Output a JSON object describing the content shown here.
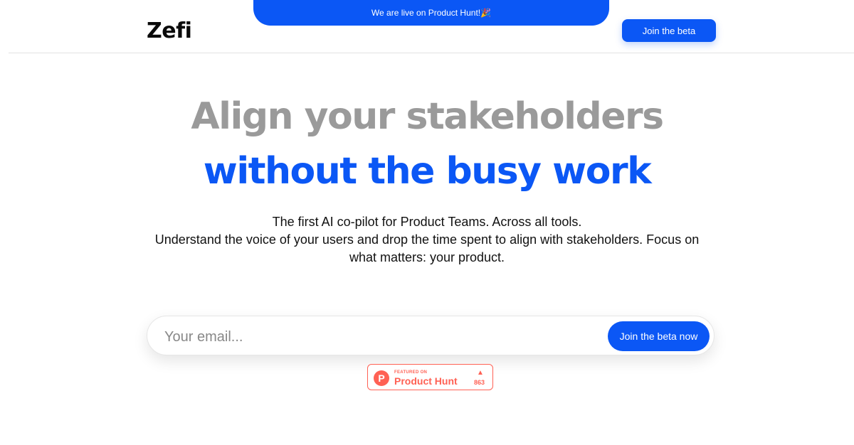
{
  "announcement": {
    "text": "We are live on Product Hunt!🎉"
  },
  "header": {
    "logo": "Zefi",
    "cta_label": "Join the beta"
  },
  "hero": {
    "headline_line1": "Align your stakeholders",
    "headline_line2": "without the busy work",
    "subtitle_line1": "The first AI co-pilot for Product Teams. Across all tools.",
    "subtitle_line2": "Understand the voice of your users and drop the time spent to align with stakeholders. Focus on what matters: your product."
  },
  "signup": {
    "email_placeholder": "Your email...",
    "email_value": "",
    "submit_label": "Join the beta now"
  },
  "product_hunt_badge": {
    "featured_label": "FEATURED ON",
    "name": "Product Hunt",
    "logo_letter": "P",
    "upvote_icon": "▲",
    "upvotes": "863"
  },
  "colors": {
    "brand_blue": "#0b57f5",
    "headline_gray": "#9a9a9a",
    "product_hunt": "#ff6154"
  }
}
